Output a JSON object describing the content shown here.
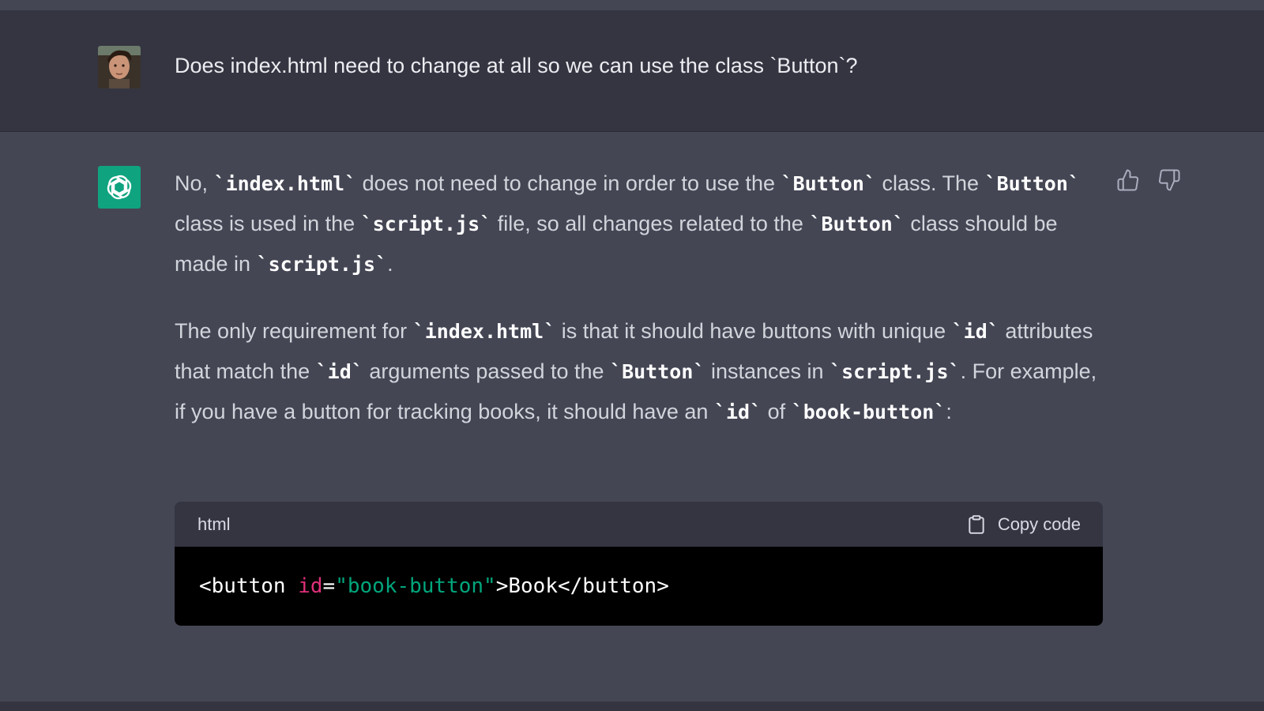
{
  "user_message": {
    "text": "Does index.html need to change at all so we can use the class `Button`?"
  },
  "assistant_message": {
    "paragraph1": {
      "t1": "No, ",
      "c1": "`index.html`",
      "t2": " does not need to change in order to use the ",
      "c2": "`Button`",
      "t3": " class. The ",
      "c3": "`Button`",
      "t4": " class is used in the ",
      "c4": "`script.js`",
      "t5": " file, so all changes related to the ",
      "c5": "`Button`",
      "t6": " class should be made in ",
      "c6": "`script.js`",
      "t7": "."
    },
    "paragraph2": {
      "t1": "The only requirement for ",
      "c1": "`index.html`",
      "t2": " is that it should have buttons with unique ",
      "c2": "`id`",
      "t3": " attributes that match the ",
      "c3": "`id`",
      "t4": " arguments passed to the ",
      "c4": "`Button`",
      "t5": " instances in ",
      "c5": "`script.js`",
      "t6": ". For example, if you have a button for tracking books, it should have an ",
      "c6": "`id`",
      "t7": " of ",
      "c7": "`book-button`",
      "t8": ":"
    },
    "code_block": {
      "language": "html",
      "copy_label": "Copy code",
      "code": {
        "tag_open": "<button ",
        "attr_name": "id",
        "equals": "=",
        "attr_value": "\"book-button\"",
        "rest": ">Book</button>"
      }
    }
  },
  "colors": {
    "user_bg": "#343541",
    "assistant_bg": "#444654",
    "brand_green": "#10a37f",
    "attr_name": "#df3079",
    "attr_value": "#00a67d"
  }
}
